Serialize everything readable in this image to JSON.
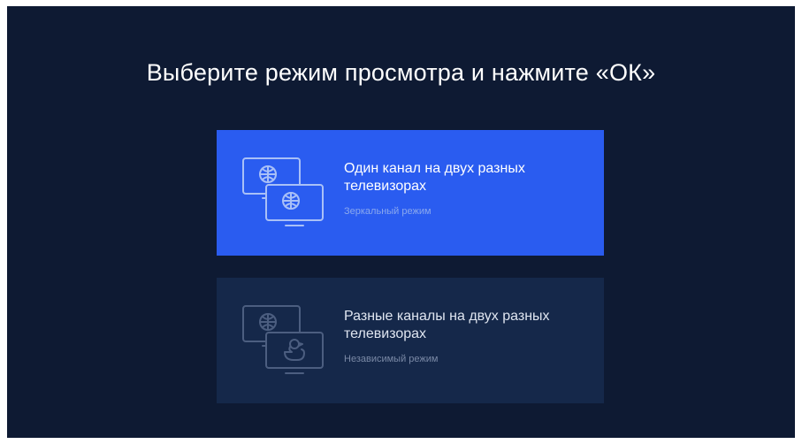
{
  "title": "Выберите режим просмотра и нажмите «ОК»",
  "options": [
    {
      "heading": "Один канал на двух разных телевизорах",
      "subtitle": "Зеркальный режим",
      "icon": "two-tv-basketball-icon",
      "state": "selected"
    },
    {
      "heading": "Разные каналы на двух разных телевизорах",
      "subtitle": "Независимый режим",
      "icon": "tv-basketball-and-duck-icon",
      "state": "unselected"
    }
  ],
  "colors": {
    "background": "#0e1a33",
    "selected_card": "#2a5cf0",
    "unselected_card": "#15284a"
  }
}
